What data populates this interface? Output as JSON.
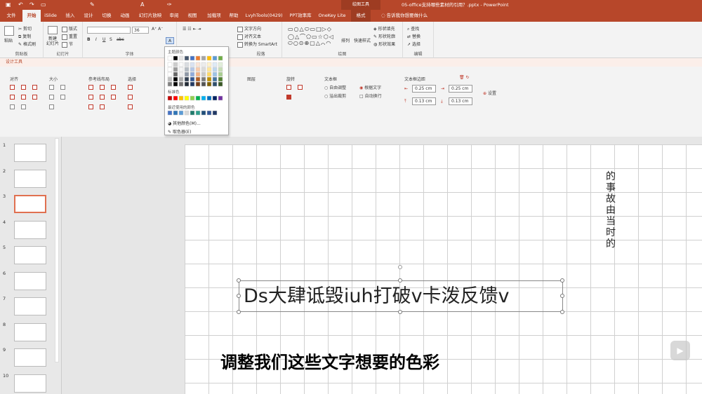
{
  "app": {
    "context_tool": "绘图工具",
    "document_title": "05-office支持哪些素材的引用？.pptx - PowerPoint"
  },
  "tabs": [
    "文件",
    "开始",
    "iSlide",
    "插入",
    "设计",
    "切换",
    "动画",
    "幻灯片放映",
    "审阅",
    "视图",
    "加载项",
    "帮助",
    "LvyhTools(0429)",
    "PPT效率库",
    "OneKey Lite",
    "格式"
  ],
  "tell_me": "告诉我你想要做什么",
  "ribbon": {
    "clipboard": {
      "paste": "粘贴",
      "cut": "剪切",
      "copy": "复制",
      "format_painter": "格式刷",
      "label": "剪贴板"
    },
    "slides": {
      "new_slide": "新建\n幻灯片",
      "layout": "版式",
      "reset": "重置",
      "section": "节",
      "label": "幻灯片"
    },
    "font": {
      "size": "36",
      "label": "字体"
    },
    "paragraph": {
      "text_direction": "文字方向",
      "align_text": "对齐文本",
      "smartart": "转换为 SmartArt",
      "label": "段落"
    },
    "drawing": {
      "arrange": "排列",
      "quick_styles": "快速样式",
      "shape_fill": "形状填充",
      "shape_outline": "形状轮廓",
      "shape_effects": "形状效果",
      "label": "绘图"
    },
    "editing": {
      "find": "查找",
      "replace": "替换",
      "select": "选择",
      "label": "编辑"
    }
  },
  "design_tools": {
    "title": "设计工具",
    "groups": [
      "对齐",
      "大小",
      "参考线布局",
      "选择",
      "图层",
      "旋转",
      "文本框"
    ],
    "autofit": "自由调整",
    "overflow": "溢出裁剪",
    "shrink": "根据文字",
    "wrap": "自动换行",
    "margin_title": "文本框边距",
    "margins": [
      "0.25 cm",
      "0.25 cm",
      "0.13 cm",
      "0.13 cm"
    ],
    "settings": "设置"
  },
  "palette": {
    "theme_colors": "主题颜色",
    "standard_colors": "标准色",
    "recent_colors": "最近使用的颜色",
    "more_colors": "其他颜色(M)...",
    "eyedropper": "取色器(E)",
    "theme_row": [
      "#ffffff",
      "#000000",
      "#e7e6e6",
      "#44546a",
      "#4472c4",
      "#ed7d31",
      "#a5a5a5",
      "#ffc000",
      "#5b9bd5",
      "#70ad47"
    ],
    "standard_row": [
      "#c00000",
      "#ff0000",
      "#ffc000",
      "#ffff00",
      "#92d050",
      "#00b050",
      "#00b0f0",
      "#0070c0",
      "#002060",
      "#7030a0"
    ],
    "recent_row": [
      "#4472c4",
      "#2e75b6",
      "#5b9bd5",
      "#d9d9d9",
      "#1f7a6b",
      "#2e9e8c",
      "#1f4e79",
      "#2f5597",
      "#203864"
    ]
  },
  "slides": {
    "numbers": [
      "1",
      "2",
      "3",
      "4",
      "5",
      "6",
      "7",
      "8",
      "9",
      "10"
    ],
    "selected": "3"
  },
  "canvas": {
    "vertical_text": "的事故由当时的",
    "main_text": "Ds大肆诋毁iuh打破v卡泼反馈v",
    "subtitle": "调整我们这些文字想要的色彩"
  }
}
